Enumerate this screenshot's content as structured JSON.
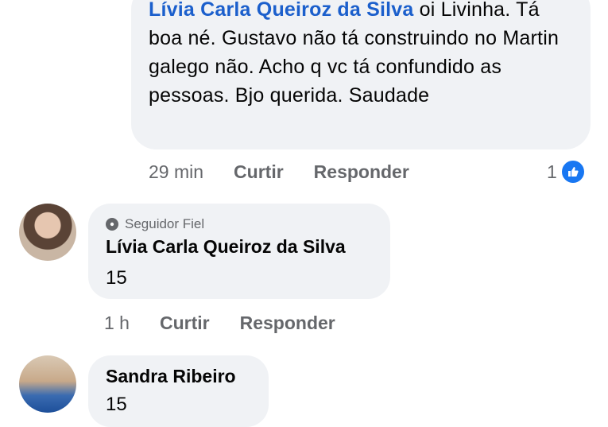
{
  "comment1": {
    "author_mention": "Lívia Carla Queiroz da Silva",
    "text": " oi Livinha. Tá boa né. Gustavo não tá construindo no Martin galego não. Acho q vc tá confundido as pessoas. Bjo querida. Saudade",
    "time": "29 min",
    "like_label": "Curtir",
    "reply_label": "Responder",
    "reaction_count": "1",
    "reaction_icon": "thumbs-up-icon"
  },
  "comment2": {
    "badge": "Seguidor Fiel",
    "badge_icon": "badge-icon",
    "author": "Lívia Carla Queiroz da Silva",
    "text": "15",
    "time": "1 h",
    "like_label": "Curtir",
    "reply_label": "Responder"
  },
  "comment3": {
    "author": "Sandra Ribeiro",
    "text": "15"
  },
  "colors": {
    "mention": "#1b5fcc",
    "bubble": "#f0f2f5",
    "secondary_text": "#65676b",
    "like_blue": "#1877f2"
  }
}
